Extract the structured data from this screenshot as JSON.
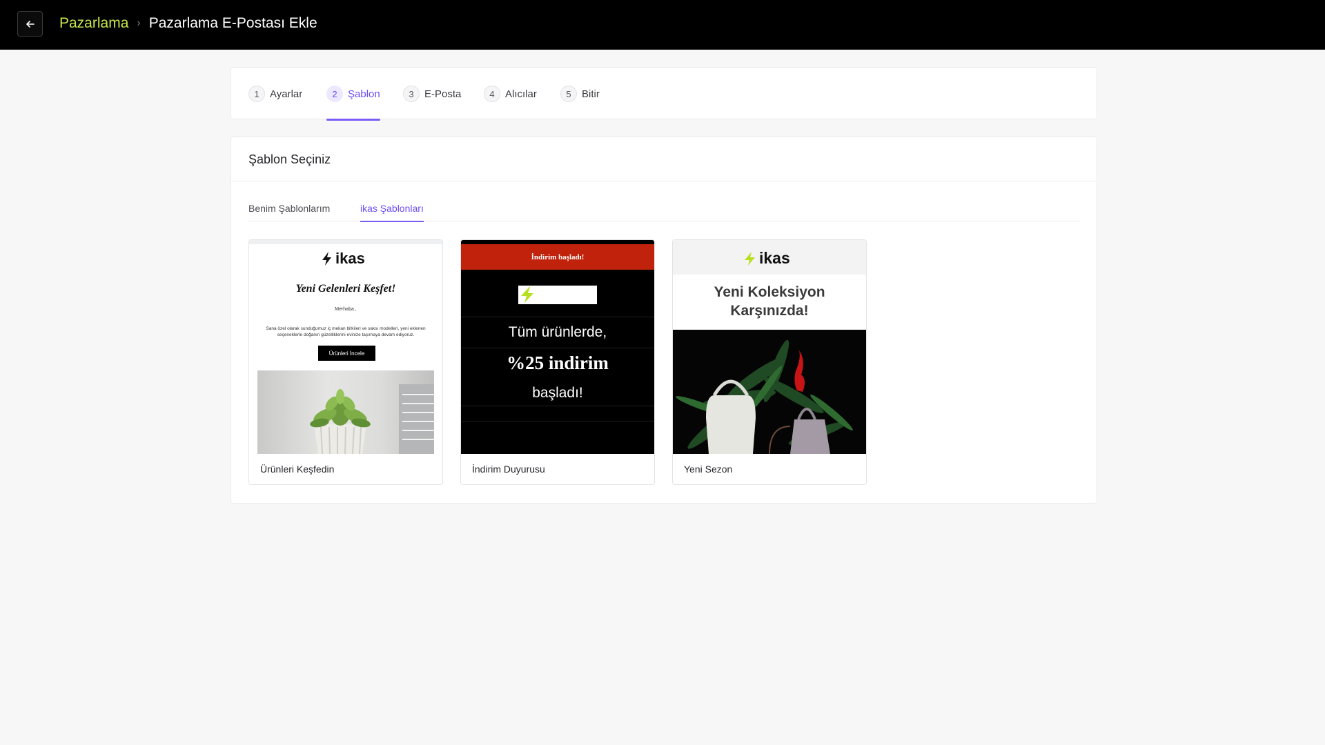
{
  "header": {
    "back_icon": "arrow-left-icon",
    "breadcrumb_root": "Pazarlama",
    "breadcrumb_separator_icon": "chevron-right-icon",
    "breadcrumb_current": "Pazarlama E-Postası Ekle"
  },
  "stepper": {
    "steps": [
      {
        "num": "1",
        "label": "Ayarlar"
      },
      {
        "num": "2",
        "label": "Şablon"
      },
      {
        "num": "3",
        "label": "E-Posta"
      },
      {
        "num": "4",
        "label": "Alıcılar"
      },
      {
        "num": "5",
        "label": "Bitir"
      }
    ],
    "active_index": 1
  },
  "template_section": {
    "title": "Şablon Seçiniz",
    "tabs": [
      {
        "label": "Benim Şablonlarım"
      },
      {
        "label": "ikas Şablonları"
      }
    ],
    "active_tab": 1,
    "templates": [
      {
        "name": "Ürünleri Keşfedin",
        "preview": {
          "logo": "ikas",
          "heading": "Yeni Gelenleri Keşfet!",
          "greeting": "Merhaba ,",
          "body": "Sana özel olarak sunduğumuz iç mekan bitkileri ve saksı modelleri, yeni eklenen seçeneklerle doğanın güzelliklerini evinize taşımaya devam ediyoruz.",
          "button": "Ürünleri İncele",
          "image": "plant-photo"
        }
      },
      {
        "name": "İndirim Duyurusu",
        "preview": {
          "banner": "İndirim başladı!",
          "line1": "Tüm ürünlerde,",
          "line2": "%25 indirim",
          "line3": "başladı!"
        }
      },
      {
        "name": "Yeni Sezon",
        "preview": {
          "logo": "ikas",
          "heading_line1": "Yeni Koleksiyon",
          "heading_line2": "Karşınızda!",
          "image": "handbags-photo"
        }
      }
    ]
  },
  "colors": {
    "accent": "#6d4cf5",
    "breadcrumb_link": "#c7e84a",
    "logo_bolt": "#b6e01f",
    "sale_banner": "#c0220c"
  }
}
